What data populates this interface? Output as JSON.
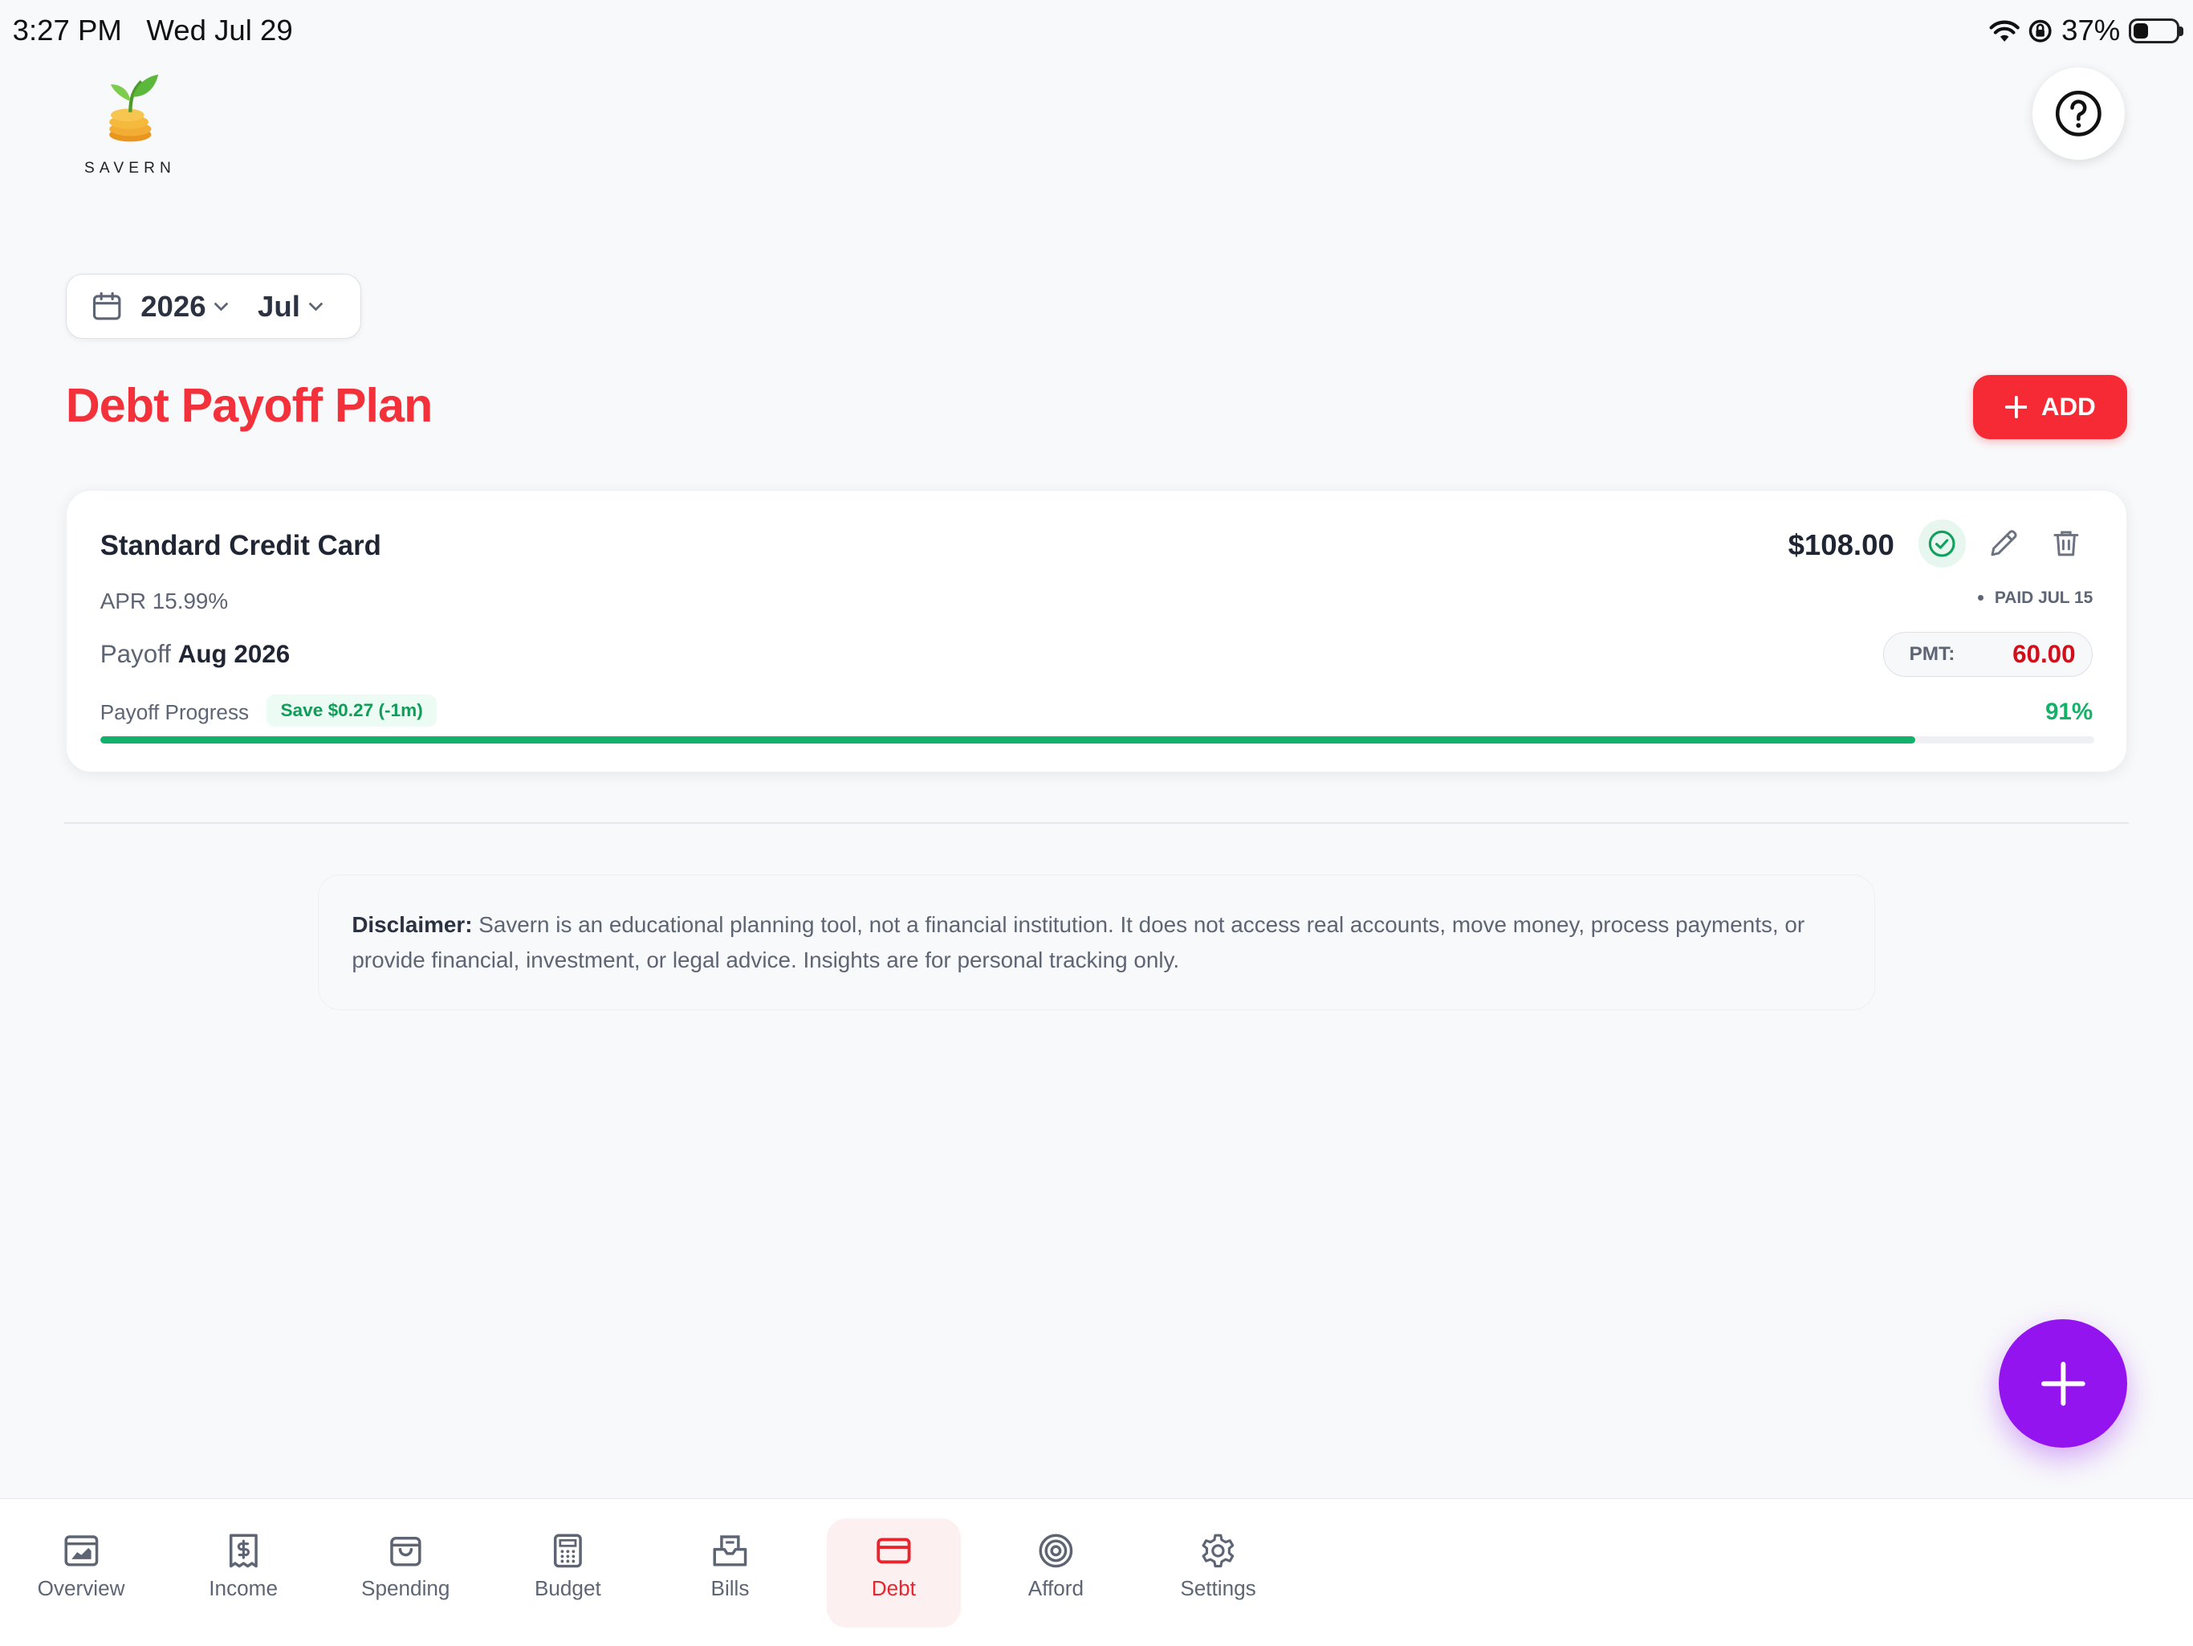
{
  "status_bar": {
    "time": "3:27 PM",
    "date": "Wed Jul 29",
    "battery": "37%",
    "battery_level": 0.37
  },
  "brand": {
    "name": "SAVERN"
  },
  "date_picker": {
    "year": "2026",
    "month": "Jul"
  },
  "page": {
    "title": "Debt Payoff Plan",
    "add_label": "ADD"
  },
  "debt": {
    "name": "Standard Credit Card",
    "apr": "APR 15.99%",
    "balance": "$108.00",
    "paid_label": "PAID JUL 15",
    "payoff_prefix": "Payoff",
    "payoff_date": "Aug 2026",
    "pmt_label": "PMT:",
    "pmt_value": "60.00",
    "progress_label": "Payoff Progress",
    "save_badge": "Save $0.27 (-1m)",
    "progress_text": "91%",
    "progress": 0.91
  },
  "disclaimer": {
    "label": "Disclaimer:",
    "text": "Savern is an educational planning tool, not a financial institution. It does not access real accounts, move money, process payments, or provide financial, investment, or legal advice. Insights are for personal tracking only."
  },
  "nav": {
    "overview": "Overview",
    "income": "Income",
    "spending": "Spending",
    "budget": "Budget",
    "bills": "Bills",
    "debt": "Debt",
    "afford": "Afford",
    "settings": "Settings"
  },
  "colors": {
    "accent": "#f2313b",
    "success": "#12b06a",
    "fab": "#9414f0"
  }
}
